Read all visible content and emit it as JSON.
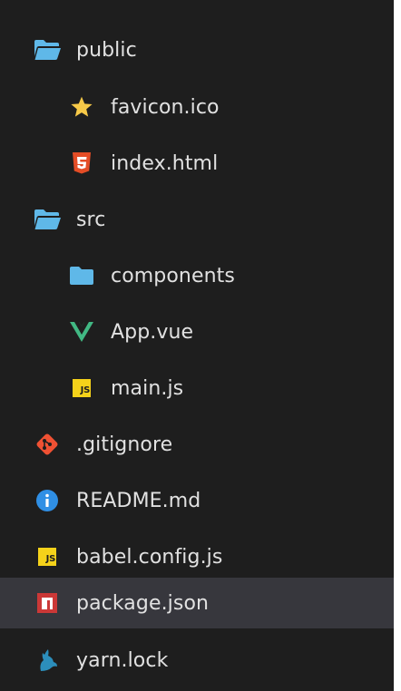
{
  "colors": {
    "background": "#1e1e1e",
    "selected_row": "#37373d",
    "text": "#e1e1e1",
    "folder": "#5fb8e8",
    "html5": "#e44d26",
    "vue": "#41b883",
    "js": "#f5d21a",
    "git": "#f05133",
    "info": "#2f8fe5",
    "npm": "#cb3837",
    "yarn": "#2c8ebb",
    "star": "#f7c948"
  },
  "tree": {
    "items": [
      {
        "label": "public",
        "icon": "folder-open-icon"
      },
      {
        "label": "favicon.ico",
        "icon": "star-icon"
      },
      {
        "label": "index.html",
        "icon": "html5-icon"
      },
      {
        "label": "src",
        "icon": "folder-open-icon"
      },
      {
        "label": "components",
        "icon": "folder-icon"
      },
      {
        "label": "App.vue",
        "icon": "vue-icon"
      },
      {
        "label": "main.js",
        "icon": "javascript-icon",
        "badge": "JS"
      },
      {
        "label": ".gitignore",
        "icon": "git-icon"
      },
      {
        "label": "README.md",
        "icon": "info-icon"
      },
      {
        "label": "babel.config.js",
        "icon": "javascript-icon",
        "badge": "JS"
      },
      {
        "label": "package.json",
        "icon": "npm-icon",
        "selected": true
      },
      {
        "label": "yarn.lock",
        "icon": "yarn-icon"
      }
    ]
  }
}
